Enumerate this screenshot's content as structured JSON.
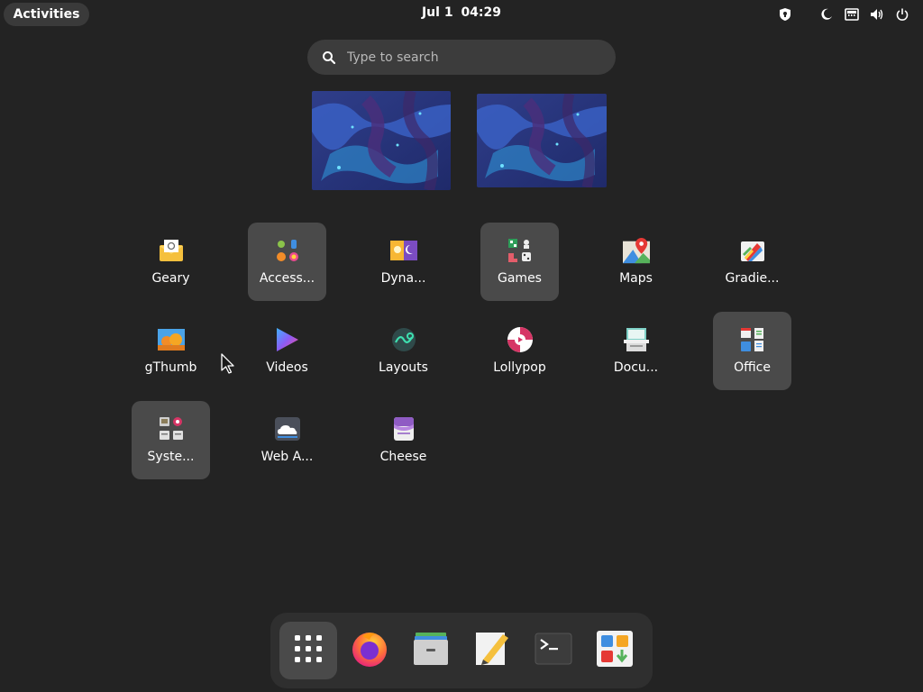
{
  "topbar": {
    "activities_label": "Activities",
    "date": "Jul 1",
    "time": "04:29",
    "status_icons": [
      "privacy-shield-icon",
      "night-light-icon",
      "network-icon",
      "volume-icon",
      "power-icon"
    ]
  },
  "search": {
    "placeholder": "Type to search",
    "value": ""
  },
  "workspaces": [
    {
      "name": "workspace-1"
    },
    {
      "name": "workspace-2"
    }
  ],
  "apps": [
    {
      "label": "Geary",
      "icon": "geary-icon",
      "folder": false
    },
    {
      "label": "Access...",
      "icon": "accessories-folder-icon",
      "folder": true
    },
    {
      "label": "Dyna...",
      "icon": "dynamic-wallpaper-icon",
      "folder": false
    },
    {
      "label": "Games",
      "icon": "games-folder-icon",
      "folder": true
    },
    {
      "label": "Maps",
      "icon": "maps-icon",
      "folder": false
    },
    {
      "label": "Gradie...",
      "icon": "gradience-icon",
      "folder": false
    },
    {
      "label": "gThumb",
      "icon": "gthumb-icon",
      "folder": false
    },
    {
      "label": "Videos",
      "icon": "videos-icon",
      "folder": false
    },
    {
      "label": "Layouts",
      "icon": "layouts-icon",
      "folder": false
    },
    {
      "label": "Lollypop",
      "icon": "lollypop-icon",
      "folder": false
    },
    {
      "label": "Docu...",
      "icon": "document-scanner-icon",
      "folder": false
    },
    {
      "label": "Office",
      "icon": "office-folder-icon",
      "folder": true
    },
    {
      "label": "Syste...",
      "icon": "system-folder-icon",
      "folder": true
    },
    {
      "label": "Web A...",
      "icon": "web-apps-icon",
      "folder": false
    },
    {
      "label": "Cheese",
      "icon": "cheese-icon",
      "folder": false
    }
  ],
  "dock": [
    {
      "name": "show-apps",
      "icon": "app-grid-icon",
      "active": true
    },
    {
      "name": "firefox",
      "icon": "firefox-icon",
      "active": false
    },
    {
      "name": "files",
      "icon": "files-icon",
      "active": false
    },
    {
      "name": "text-editor",
      "icon": "text-editor-icon",
      "active": false
    },
    {
      "name": "terminal",
      "icon": "terminal-icon",
      "active": false
    },
    {
      "name": "software",
      "icon": "software-icon",
      "active": false
    }
  ],
  "colors": {
    "background": "#232323",
    "folder_tile": "#4a4a4a",
    "search_bg": "#3c3c3c",
    "dock_bg": "#2f2f2f"
  }
}
